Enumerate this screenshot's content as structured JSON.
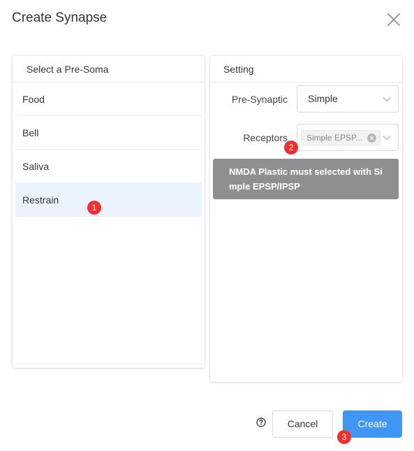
{
  "dialog": {
    "title": "Create Synapse",
    "close_icon": "close-icon"
  },
  "left_panel": {
    "header": "Select a Pre-Soma",
    "items": [
      {
        "label": "Food",
        "selected": false
      },
      {
        "label": "Bell",
        "selected": false
      },
      {
        "label": "Saliva",
        "selected": false
      },
      {
        "label": "Restrain",
        "selected": true
      }
    ]
  },
  "right_panel": {
    "header": "Setting",
    "pre_synaptic": {
      "label": "Pre-Synaptic",
      "value": "Simple"
    },
    "receptors": {
      "label": "Receptors",
      "tag": "Simple EPSP..."
    },
    "tooltip": "NMDA Plastic must selected with Simple EPSP/IPSP"
  },
  "footer": {
    "help_icon": "question-circle-icon",
    "cancel_label": "Cancel",
    "create_label": "Create"
  },
  "markers": [
    "1",
    "2",
    "3"
  ],
  "colors": {
    "primary": "#4096f5",
    "selected_bg": "#ebf3fe",
    "marker": "#f0302e",
    "tooltip_bg": "#8f8f91"
  }
}
